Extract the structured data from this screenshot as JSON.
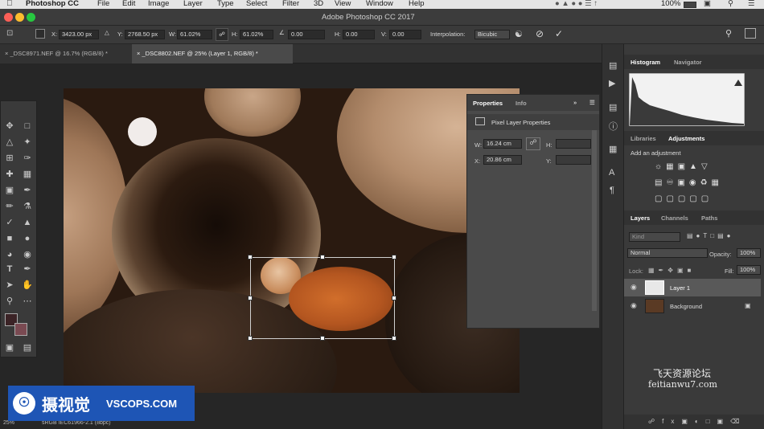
{
  "menubar": {
    "app_name": "Photoshop CC",
    "items": [
      "File",
      "Edit",
      "Image",
      "Layer",
      "Type",
      "Select",
      "Filter",
      "3D",
      "View",
      "Window",
      "Help"
    ],
    "battery": "100%"
  },
  "window": {
    "title": "Adobe Photoshop CC 2017"
  },
  "options_bar": {
    "x_label": "X:",
    "x_value": "3423.00 px",
    "y_label": "Y:",
    "y_value": "2768.50 px",
    "w_label": "W:",
    "w_value": "61.02%",
    "h_label": "H:",
    "h_value": "61.02%",
    "angle_value": "0.00",
    "hskew_label": "H:",
    "hskew_value": "0.00",
    "vskew_label": "V:",
    "vskew_value": "0.00",
    "interp_label": "Interpolation:",
    "interp_value": "Bicubic"
  },
  "doc_tabs": [
    {
      "label": "_DSC8971.NEF @ 16.7% (RGB/8) *",
      "active": false
    },
    {
      "label": "_DSC8802.NEF @ 25% (Layer 1, RGB/8) *",
      "active": true
    }
  ],
  "properties": {
    "tab_properties": "Properties",
    "tab_info": "Info",
    "heading": "Pixel Layer Properties",
    "w_label": "W:",
    "w_value": "16.24 cm",
    "h_label": "H:",
    "h_value": "",
    "x_label": "X:",
    "x_value": "20.86 cm",
    "y_label": "Y:",
    "y_value": ""
  },
  "histogram": {
    "tab_histogram": "Histogram",
    "tab_navigator": "Navigator"
  },
  "adjustments": {
    "tab_libraries": "Libraries",
    "tab_adjustments": "Adjustments",
    "heading": "Add an adjustment"
  },
  "layers": {
    "tab_layers": "Layers",
    "tab_channels": "Channels",
    "tab_paths": "Paths",
    "filter_placeholder": "Kind",
    "blend_mode": "Normal",
    "opacity_label": "Opacity:",
    "opacity_value": "100%",
    "lock_label": "Lock:",
    "fill_label": "Fill:",
    "fill_value": "100%",
    "items": [
      {
        "name": "Layer 1",
        "selected": true
      },
      {
        "name": "Background",
        "selected": false
      }
    ]
  },
  "status": {
    "zoom": "25%",
    "profile": "sRGB IEC61966-2.1 (8bpc)"
  },
  "watermark": {
    "brand": "摄视觉",
    "site": "VSCOPS.COM",
    "wm_cn": "飞天资源论坛",
    "wm_url": "feitianwu7.com"
  },
  "colors": {
    "accent": "#1e55b5",
    "foreground_swatch": "#3b2326",
    "background_swatch": "#7a4a52",
    "canvas_bg": "#262626"
  }
}
